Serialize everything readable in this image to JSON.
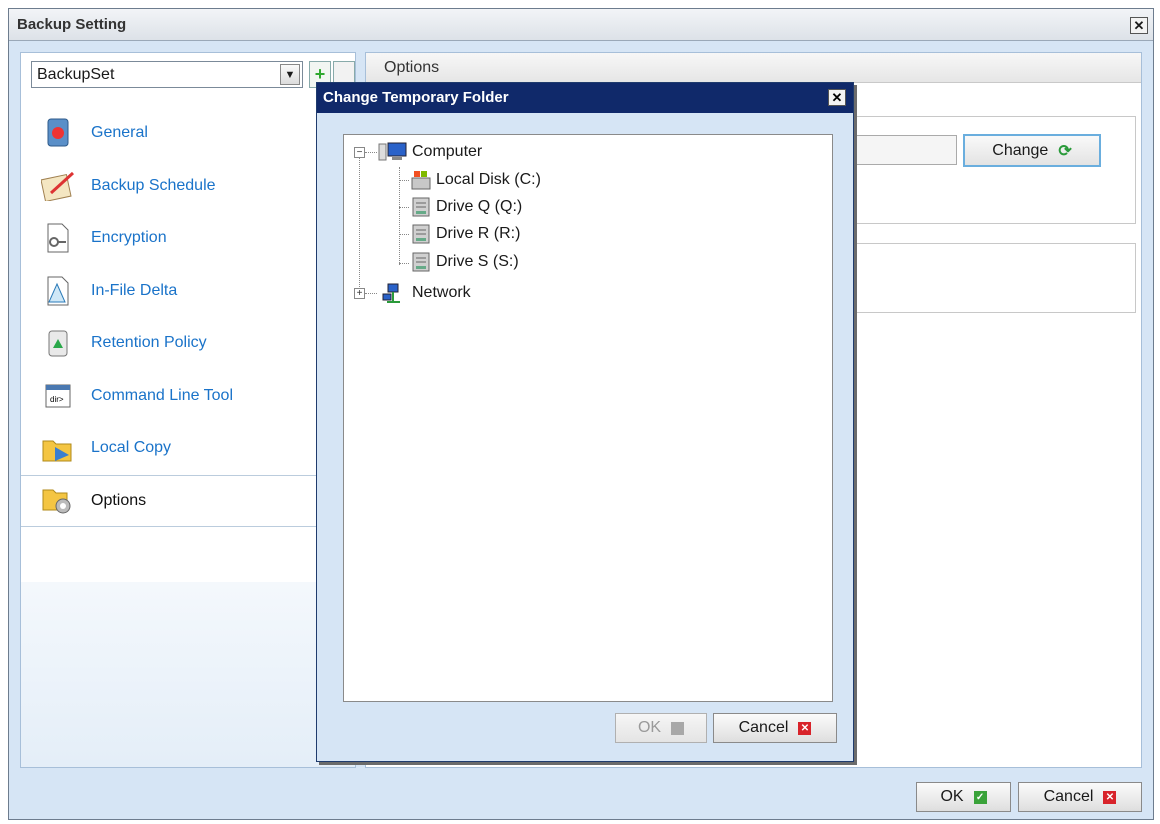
{
  "window": {
    "title": "Backup Setting"
  },
  "sidebar": {
    "backupset_value": "BackupSet",
    "items": [
      {
        "label": "General",
        "icon": "general-icon"
      },
      {
        "label": "Backup Schedule",
        "icon": "schedule-icon"
      },
      {
        "label": "Encryption",
        "icon": "encryption-icon"
      },
      {
        "label": "In-File Delta",
        "icon": "delta-icon"
      },
      {
        "label": "Retention Policy",
        "icon": "recycle-icon"
      },
      {
        "label": "Command Line Tool",
        "icon": "cmd-icon"
      },
      {
        "label": "Local Copy",
        "icon": "local-copy-icon"
      },
      {
        "label": "Options",
        "icon": "options-icon"
      }
    ]
  },
  "main": {
    "header": "Options",
    "change_label": "Change"
  },
  "footer": {
    "ok_label": "OK",
    "cancel_label": "Cancel"
  },
  "dialog": {
    "title": "Change Temporary Folder",
    "tree": {
      "root": "Computer",
      "drives": [
        "Local Disk (C:)",
        "Drive Q (Q:)",
        "Drive R (R:)",
        "Drive S (S:)"
      ],
      "network": "Network"
    },
    "ok_label": "OK",
    "cancel_label": "Cancel"
  },
  "colors": {
    "accent": "#1a73c9",
    "dialog_title": "#10296a",
    "panel": "#d6e5f5"
  }
}
